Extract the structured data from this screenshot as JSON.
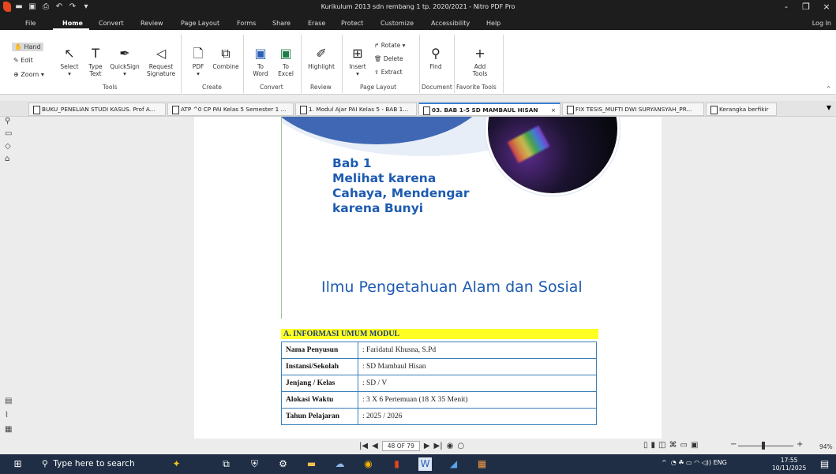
{
  "titlebar": {
    "title": "Kurikulum 2013 sdn rembang 1 tp. 2020/2021 - Nitro PDF Pro",
    "minimize": "-",
    "restore": "❐",
    "close": "×"
  },
  "menu": {
    "tabs": [
      "File",
      "Home",
      "Convert",
      "Review",
      "Page Layout",
      "Forms",
      "Share",
      "Erase",
      "Protect",
      "Customize",
      "Accessibility",
      "Help"
    ],
    "active": "Home",
    "login": "Log In"
  },
  "ribbon": {
    "left": {
      "hand": "Hand",
      "edit": "Edit",
      "zoom": "Zoom ▾"
    },
    "tools": [
      {
        "label": "Select",
        "icon": "cursor-icon"
      },
      {
        "label": "Type Text",
        "icon": "type-text-icon"
      },
      {
        "label": "QuickSign",
        "icon": "pen-icon"
      },
      {
        "label": "Request Signature",
        "icon": "signature-icon"
      }
    ],
    "groups": {
      "tools": "Tools",
      "create": "Create",
      "convert": "Convert",
      "review": "Review",
      "page_layout": "Page Layout",
      "document": "Document",
      "favorite": "Favorite Tools"
    },
    "create": [
      {
        "label": "PDF"
      },
      {
        "label": "Combine"
      }
    ],
    "convert": [
      {
        "label": "To Word"
      },
      {
        "label": "To Excel"
      }
    ],
    "review": [
      {
        "label": "Highlight"
      }
    ],
    "page_layout": {
      "insert": "Insert",
      "rotate": "Rotate ▾",
      "delete": "Delete",
      "extract": "Extract"
    },
    "document": [
      {
        "label": "Find"
      }
    ],
    "favorite": [
      {
        "label": "Add Tools"
      }
    ]
  },
  "doc_tabs": [
    {
      "label": "BUKU_PENELIAN STUDI KASUS. Prof A...",
      "active": false
    },
    {
      "label": "ATP ^0 CP PAI Kelas 5 Semester 1 ...",
      "active": false
    },
    {
      "label": "1. Modul Ajar PAI Kelas 5 - BAB 1...",
      "active": false
    },
    {
      "label": "03. BAB 1-5 SD MAMBAUL HISAN",
      "active": true,
      "close": "×"
    },
    {
      "label": "FIX TESIS_MUFTI DWI SURYANSYAH_PR...",
      "active": false
    },
    {
      "label": "Kerangka berfikir",
      "active": false
    }
  ],
  "page": {
    "bab": [
      "Bab 1",
      "Melihat karena",
      "Cahaya, Mendengar",
      "karena Bunyi"
    ],
    "subject": "Ilmu Pengetahuan Alam dan Sosial",
    "section_heading": "A.  INFORMASI UMUM MODUL",
    "info_rows": [
      {
        "key": "Nama Penyusun",
        "value": ": Faridatul Khusna, S.Pd"
      },
      {
        "key": "Instansi/Sekolah",
        "value": ": SD Mambaul Hisan"
      },
      {
        "key": "Jenjang / Kelas",
        "value": ": SD / V"
      },
      {
        "key": "Alokasi Waktu",
        "value": ": 3 X 6 Pertemuan (18 X 35 Menit)"
      },
      {
        "key": "Tahun Pelajaran",
        "value": ": 2025 / 2026"
      }
    ]
  },
  "status": {
    "page_indicator": "48 OF 79",
    "zoom": "94%"
  },
  "taskbar": {
    "search_placeholder": "Type here to search",
    "tray": "^  ENG",
    "time": "17:55",
    "date": "10/11/2025"
  }
}
